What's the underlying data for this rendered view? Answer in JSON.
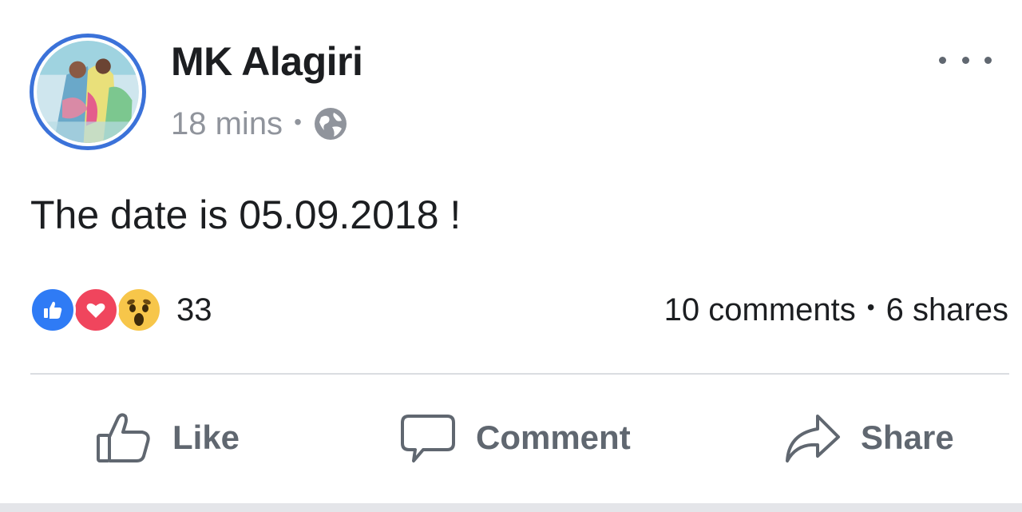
{
  "post": {
    "author": "MK Alagiri",
    "time": "18 mins",
    "meta_separator": "•",
    "privacy_icon": "globe-icon",
    "text": "The date is 05.09.2018 !",
    "more_icon": "more-options-icon"
  },
  "reactions": {
    "types": [
      "like",
      "love",
      "wow"
    ],
    "count": "33"
  },
  "engagement": {
    "comments": "10 comments",
    "separator": "•",
    "shares": "6 shares"
  },
  "actions": {
    "like": "Like",
    "comment": "Comment",
    "share": "Share"
  },
  "colors": {
    "name_text": "#1c1e21",
    "meta_text": "#90949c",
    "action_text": "#606770",
    "avatar_ring": "#3b72d9",
    "like_blue": "#2f7bf5",
    "love_red": "#f0455d",
    "wow_yellow": "#f7c64a",
    "divider": "#dadde1"
  }
}
